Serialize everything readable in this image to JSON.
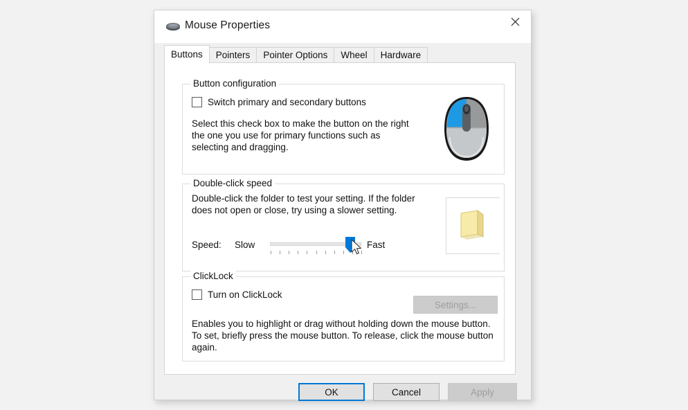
{
  "window": {
    "title": "Mouse Properties",
    "icon": "mouse-icon",
    "close_label": "Close"
  },
  "tabs": [
    {
      "label": "Buttons",
      "active": true
    },
    {
      "label": "Pointers",
      "active": false
    },
    {
      "label": "Pointer Options",
      "active": false
    },
    {
      "label": "Wheel",
      "active": false
    },
    {
      "label": "Hardware",
      "active": false
    }
  ],
  "button_configuration": {
    "group_title": "Button configuration",
    "switch_checkbox_label": "Switch primary and secondary buttons",
    "switch_checkbox_checked": false,
    "description": "Select this check box to make the button on the right the one you use for primary functions such as selecting and dragging.",
    "mouse_image_alt": "mouse-preview-left-button-highlighted",
    "highlight_color": "#1e9ae4"
  },
  "double_click_speed": {
    "group_title": "Double-click speed",
    "description": "Double-click the folder to test your setting. If the folder does not open or close, try using a slower setting.",
    "speed_label": "Speed:",
    "slow_label": "Slow",
    "fast_label": "Fast",
    "slider_value_percent": 92,
    "tick_count": 11,
    "thumb_color": "#0078d7",
    "folder_alt": "closed-yellow-folder",
    "folder_color": "#f7e8a8"
  },
  "clicklock": {
    "group_title": "ClickLock",
    "checkbox_label": "Turn on ClickLock",
    "checkbox_checked": false,
    "settings_button_label": "Settings...",
    "settings_button_enabled": false,
    "description": "Enables you to highlight or drag without holding down the mouse button. To set, briefly press the mouse button. To release, click the mouse button again."
  },
  "footer": {
    "ok_label": "OK",
    "cancel_label": "Cancel",
    "apply_label": "Apply",
    "apply_enabled": false,
    "focus_color": "#0078d7"
  },
  "cursor": {
    "type": "arrow-pointer"
  }
}
